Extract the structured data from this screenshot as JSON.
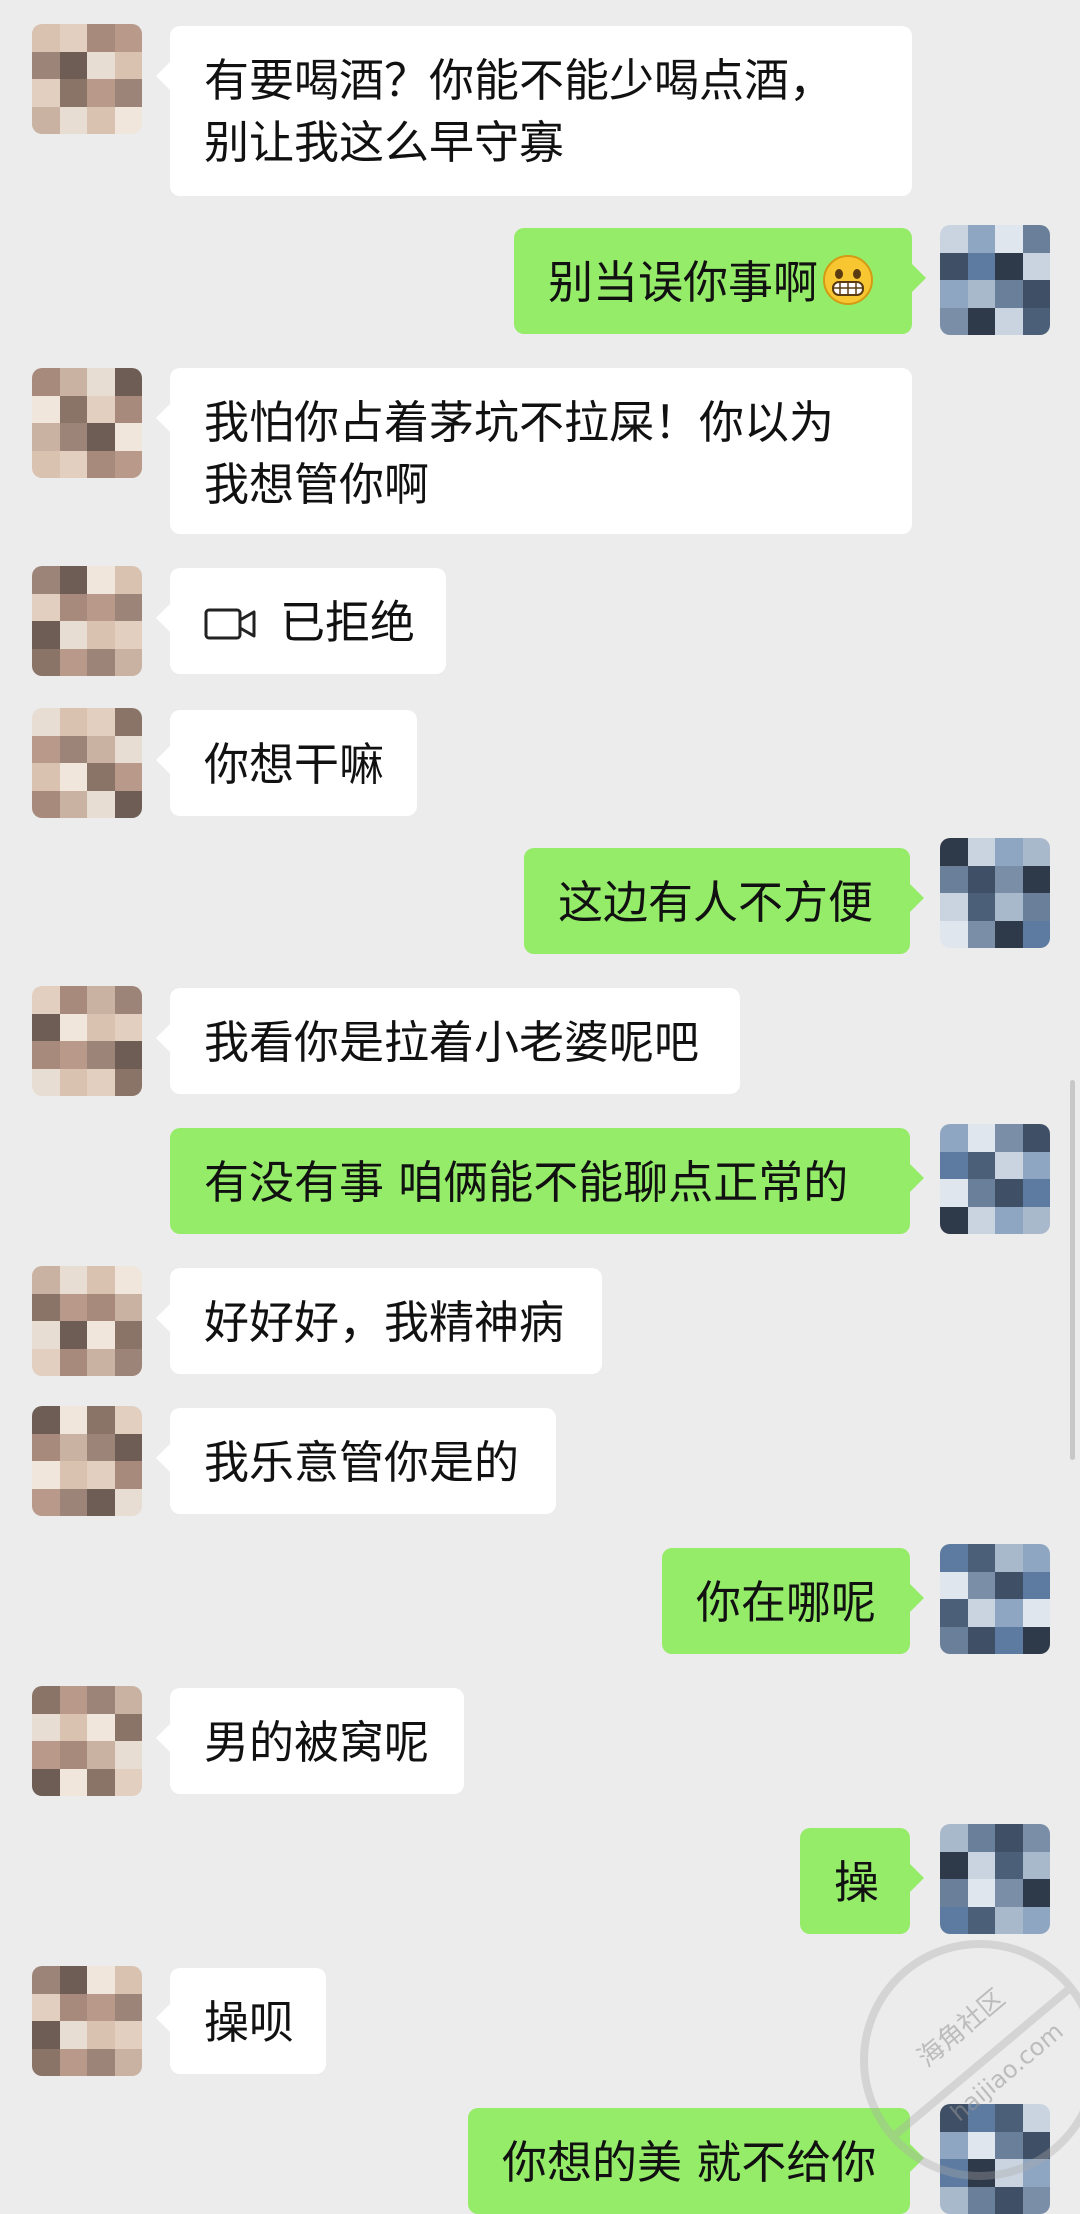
{
  "messages": [
    {
      "from": "left",
      "text": "有要喝酒？你能不能少喝点酒，别让我这么早守寡"
    },
    {
      "from": "right",
      "text": "别当误你事啊",
      "emoji": "grinning-face"
    },
    {
      "from": "left",
      "text": "我怕你占着茅坑不拉屎！你以为我想管你啊"
    },
    {
      "from": "left",
      "icon": "video-call-icon",
      "text": "已拒绝"
    },
    {
      "from": "left",
      "text": "你想干嘛"
    },
    {
      "from": "right",
      "text": "这边有人不方便"
    },
    {
      "from": "left",
      "text": "我看你是拉着小老婆呢吧"
    },
    {
      "from": "right",
      "text": "有没有事 咱俩能不能聊点正常的"
    },
    {
      "from": "left",
      "text": "好好好，我精神病"
    },
    {
      "from": "left",
      "text": "我乐意管你是的"
    },
    {
      "from": "right",
      "text": "你在哪呢"
    },
    {
      "from": "left",
      "text": "男的被窝呢"
    },
    {
      "from": "right",
      "text": "操"
    },
    {
      "from": "left",
      "text": "操呗"
    },
    {
      "from": "right",
      "text": "你想的美 就不给你"
    }
  ],
  "watermark": {
    "text": "海角社区",
    "url": "haijiao.com"
  },
  "colors": {
    "background": "#ececec",
    "outgoing_bubble": "#95ec69",
    "incoming_bubble": "#ffffff"
  }
}
